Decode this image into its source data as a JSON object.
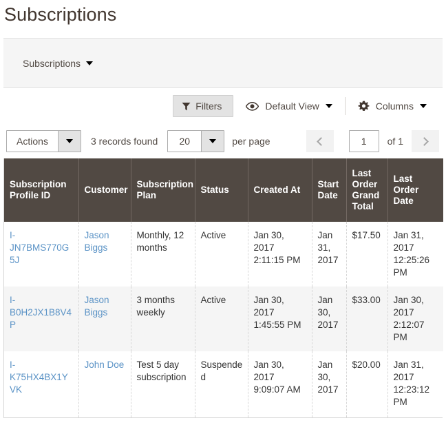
{
  "page": {
    "title": "Subscriptions"
  },
  "tab_strip": {
    "label": "Subscriptions",
    "caret_icon": "chevron-down-icon"
  },
  "toolbar": {
    "filters_label": "Filters",
    "filters_icon": "funnel-icon",
    "view_label": "Default View",
    "view_icon": "eye-icon",
    "columns_label": "Columns",
    "columns_icon": "gear-icon",
    "caret_icon": "chevron-down-icon"
  },
  "admin_bar": {
    "actions_label": "Actions",
    "records_found": "3 records found",
    "per_page_value": "20",
    "per_page_label": "per page",
    "prev_icon": "chevron-left-icon",
    "next_icon": "chevron-right-icon",
    "page_value": "1",
    "page_total_label": "of 1"
  },
  "grid": {
    "columns": [
      "Subscription Profile ID",
      "Customer",
      "Subscription Plan",
      "Status",
      "Created At",
      "Start Date",
      "Last Order Grand Total",
      "Last Order Date"
    ],
    "rows": [
      {
        "profile_id": "I-JN7BMS770G5J",
        "customer": "Jason Biggs",
        "plan": "Monthly, 12 months",
        "status": "Active",
        "created_at": "Jan 30, 2017 2:11:15 PM",
        "start_date": "Jan 31, 2017",
        "last_order_total": "$17.50",
        "last_order_date": "Jan 31, 2017 12:25:26 PM"
      },
      {
        "profile_id": "I-B0H2JX1B8V4P",
        "customer": "Jason Biggs",
        "plan": "3 months weekly",
        "status": "Active",
        "created_at": "Jan 30, 2017 1:45:55 PM",
        "start_date": "Jan 30, 2017",
        "last_order_total": "$33.00",
        "last_order_date": "Jan 30, 2017 2:12:07 PM"
      },
      {
        "profile_id": "I-K75HX4BX1YVK",
        "customer": "John Doe",
        "plan": "Test 5 day subscription",
        "status": "Suspended",
        "created_at": "Jan 30, 2017 9:09:07 AM",
        "start_date": "Jan 30, 2017",
        "last_order_total": "$20.00",
        "last_order_date": "Jan 31, 2017 12:23:12 PM"
      }
    ]
  },
  "colors": {
    "header_bg": "#514943",
    "link": "#5b93c6",
    "title": "#41362f",
    "stripe": "#f5f5f5"
  }
}
